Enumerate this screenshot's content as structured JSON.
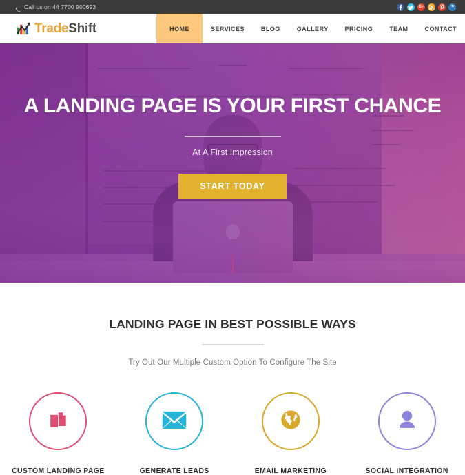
{
  "topbar": {
    "phone_icon": "phone-icon",
    "phone_text": "Call us on 44 7700 900693",
    "socials": [
      {
        "name": "facebook",
        "glyph": "f",
        "color": "#3b5998"
      },
      {
        "name": "twitter",
        "glyph": "t",
        "color": "#2ec3e8"
      },
      {
        "name": "google-plus",
        "glyph": "G+",
        "color": "#e0402a"
      },
      {
        "name": "rss",
        "glyph": "r",
        "color": "#f2a62b"
      },
      {
        "name": "pinterest",
        "glyph": "P",
        "color": "#e0402a"
      },
      {
        "name": "linkedin",
        "glyph": "in",
        "color": "#2f7fc0"
      }
    ],
    "bar_color": "#3b3b3b"
  },
  "header": {
    "logo_icon": "bar-chart-arrow-icon",
    "logo_first": "Trade",
    "logo_second": "Shift",
    "logo_first_color": "#e8a33d",
    "logo_second_color": "#4a4a4a",
    "nav": [
      {
        "label": "HOME",
        "active": true
      },
      {
        "label": "SERVICES",
        "active": false
      },
      {
        "label": "BLOG",
        "active": false
      },
      {
        "label": "GALLERY",
        "active": false
      },
      {
        "label": "PRICING",
        "active": false
      },
      {
        "label": "TEAM",
        "active": false
      },
      {
        "label": "CONTACT",
        "active": false
      }
    ],
    "active_color": "#fbc87e"
  },
  "hero": {
    "title": "A LANDING PAGE IS YOUR FIRST CHANCE",
    "subtitle": "At A First Impression",
    "cta_label": "START TODAY",
    "cta_color": "#e2b12e",
    "overlay_color": "#7e3a96",
    "background_scene": "person-at-laptop-with-whiteboard"
  },
  "features": {
    "heading": "LANDING PAGE IN BEST POSSIBLE WAYS",
    "subheading": "Try Out Our Multiple Custom Option To Configure The Site",
    "cards": [
      {
        "icon": "documents-icon",
        "label": "CUSTOM LANDING PAGE",
        "color": "#dd4e72"
      },
      {
        "icon": "envelope-icon",
        "label": "GENERATE LEADS",
        "color": "#25b4d8"
      },
      {
        "icon": "globe-icon",
        "label": "EMAIL MARKETING",
        "color": "#d9a82a"
      },
      {
        "icon": "person-icon",
        "label": "SOCIAL INTEGRATION",
        "color": "#8b84da"
      }
    ]
  }
}
